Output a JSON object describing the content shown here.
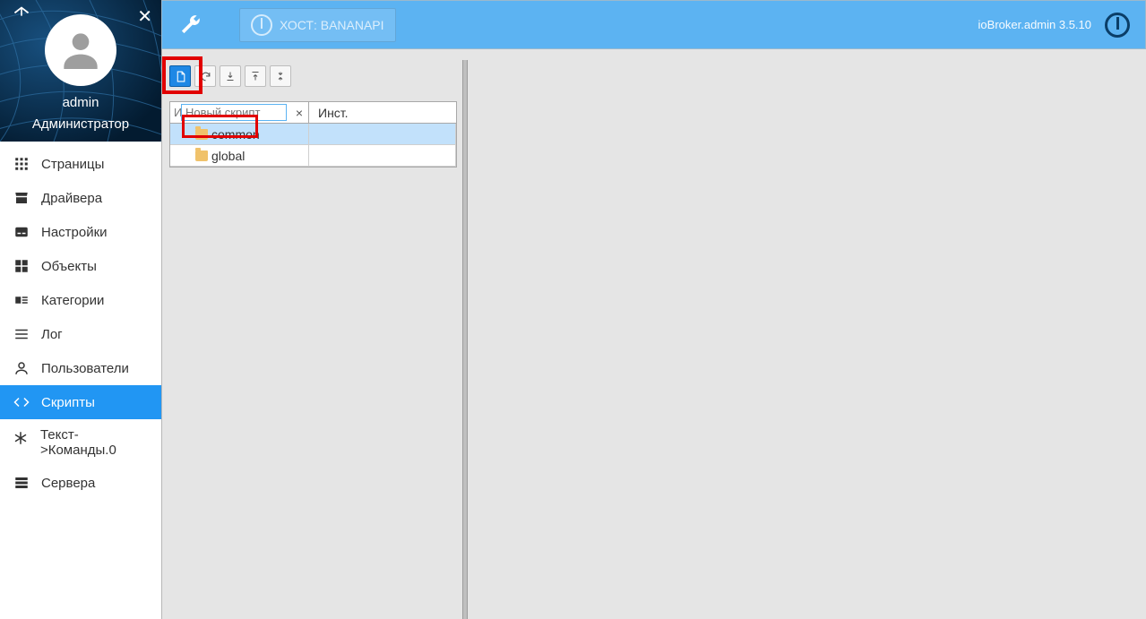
{
  "sidebar": {
    "username": "admin",
    "role": "Администратор",
    "items": [
      {
        "label": "Страницы"
      },
      {
        "label": "Драйвера"
      },
      {
        "label": "Настройки"
      },
      {
        "label": "Объекты"
      },
      {
        "label": "Категории"
      },
      {
        "label": "Лог"
      },
      {
        "label": "Пользователи"
      },
      {
        "label": "Скрипты"
      },
      {
        "label": "Текст->Команды.0"
      },
      {
        "label": "Сервера"
      }
    ]
  },
  "header": {
    "host_label": "ХОСТ: BANANAPI",
    "version": "ioBroker.admin 3.5.10"
  },
  "tree": {
    "filter_placeholder": "Новый скрипт",
    "name_prefix": "И",
    "inst_header": "Инст.",
    "rows": [
      {
        "name": "common",
        "selected": true
      },
      {
        "name": "global",
        "selected": false
      }
    ]
  }
}
